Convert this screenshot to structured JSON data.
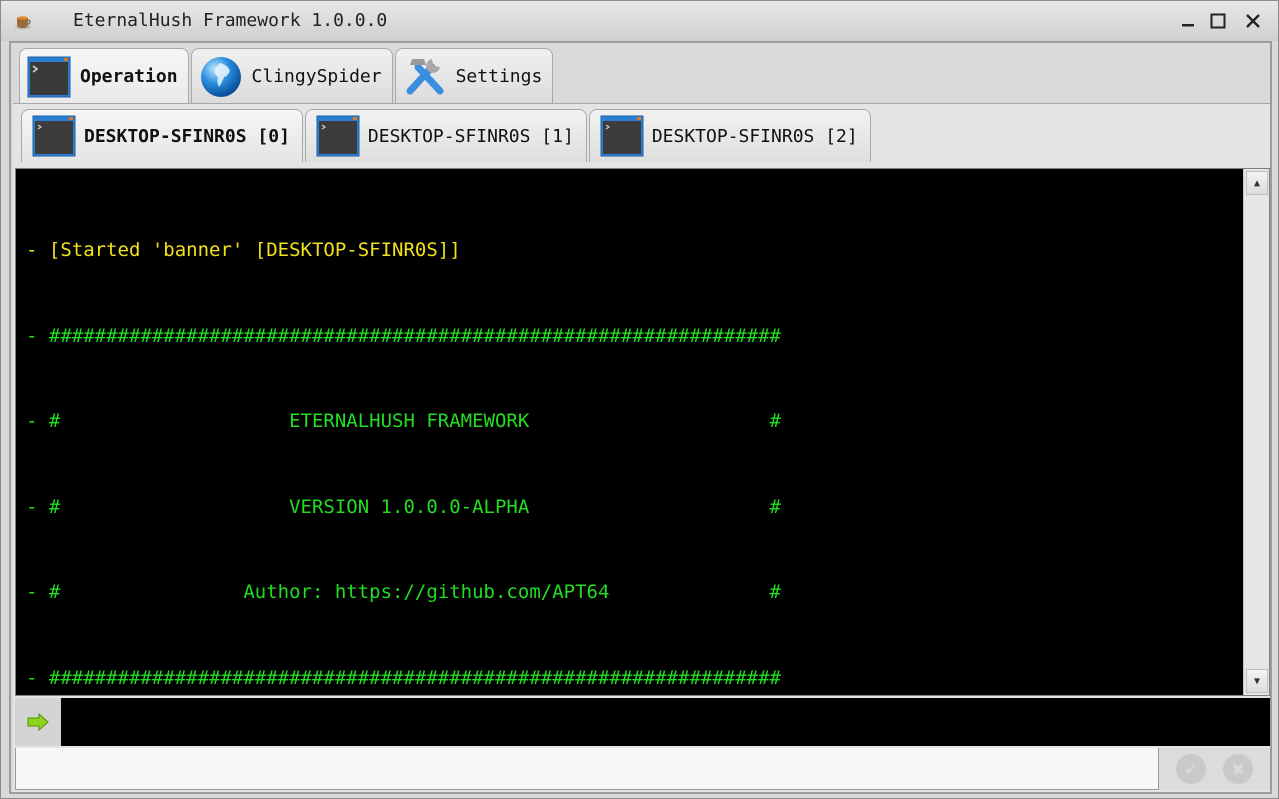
{
  "window": {
    "title": "EternalHush Framework 1.0.0.0",
    "controls": {
      "minimize": "minimize",
      "maximize": "maximize",
      "close": "close"
    }
  },
  "main_tabs": [
    {
      "label": "Operation",
      "icon": "terminal-icon",
      "active": true
    },
    {
      "label": "ClingySpider",
      "icon": "globe-icon",
      "active": false
    },
    {
      "label": "Settings",
      "icon": "tools-icon",
      "active": false
    }
  ],
  "session_tabs": [
    {
      "label": "DESKTOP-SFINR0S [0]",
      "active": true
    },
    {
      "label": "DESKTOP-SFINR0S [1]",
      "active": false
    },
    {
      "label": "DESKTOP-SFINR0S [2]",
      "active": false
    }
  ],
  "console": {
    "lines": [
      {
        "text": "- [Started 'banner' [DESKTOP-SFINR0S]]",
        "color": "#f2e21a"
      },
      {
        "text": "- ################################################################",
        "color": "#22dd22"
      },
      {
        "text": "- #                    ETERNALHUSH FRAMEWORK                     #",
        "color": "#22dd22"
      },
      {
        "text": "- #                    VERSION 1.0.0.0-ALPHA                     #",
        "color": "#22dd22"
      },
      {
        "text": "- #                Author: https://github.com/APT64              #",
        "color": "#22dd22"
      },
      {
        "text": "- ################################################################",
        "color": "#22dd22"
      }
    ]
  },
  "command_input": {
    "value": "",
    "placeholder": ""
  },
  "status": {
    "text": ""
  },
  "buttons": {
    "confirm": "✔",
    "cancel": "✖"
  },
  "colors": {
    "console_bg": "#000000",
    "banner_green": "#22dd22",
    "started_yellow": "#f2e21a",
    "prompt_arrow": "#7ec41a"
  }
}
